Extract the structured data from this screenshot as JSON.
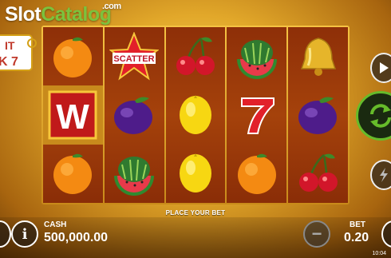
{
  "watermark": {
    "slot": "Slot",
    "catalog": "Catalog",
    "com": ".com"
  },
  "logo": {
    "line1": "IT",
    "line2": "K 7"
  },
  "reels": [
    [
      "orange",
      "wild",
      "orange"
    ],
    [
      "scatter",
      "plum",
      "watermelon"
    ],
    [
      "cherry",
      "lemon",
      "lemon"
    ],
    [
      "watermelon",
      "seven",
      "orange"
    ],
    [
      "bell",
      "plum",
      "cherry"
    ]
  ],
  "symbols": {
    "scatter_text": "SCATTER",
    "wild_text": "W"
  },
  "hint": "PLACE YOUR BET",
  "cash": {
    "label": "CASH",
    "value": "500,000.00"
  },
  "bet": {
    "label": "BET",
    "value": "0.20"
  },
  "buttons": {
    "info": "i",
    "minus": "−"
  },
  "clock": "10:04",
  "colors": {
    "spin_ring": "#66bb2a",
    "reel_bg": "#9b3a0a",
    "frame": "#f0b83a"
  }
}
